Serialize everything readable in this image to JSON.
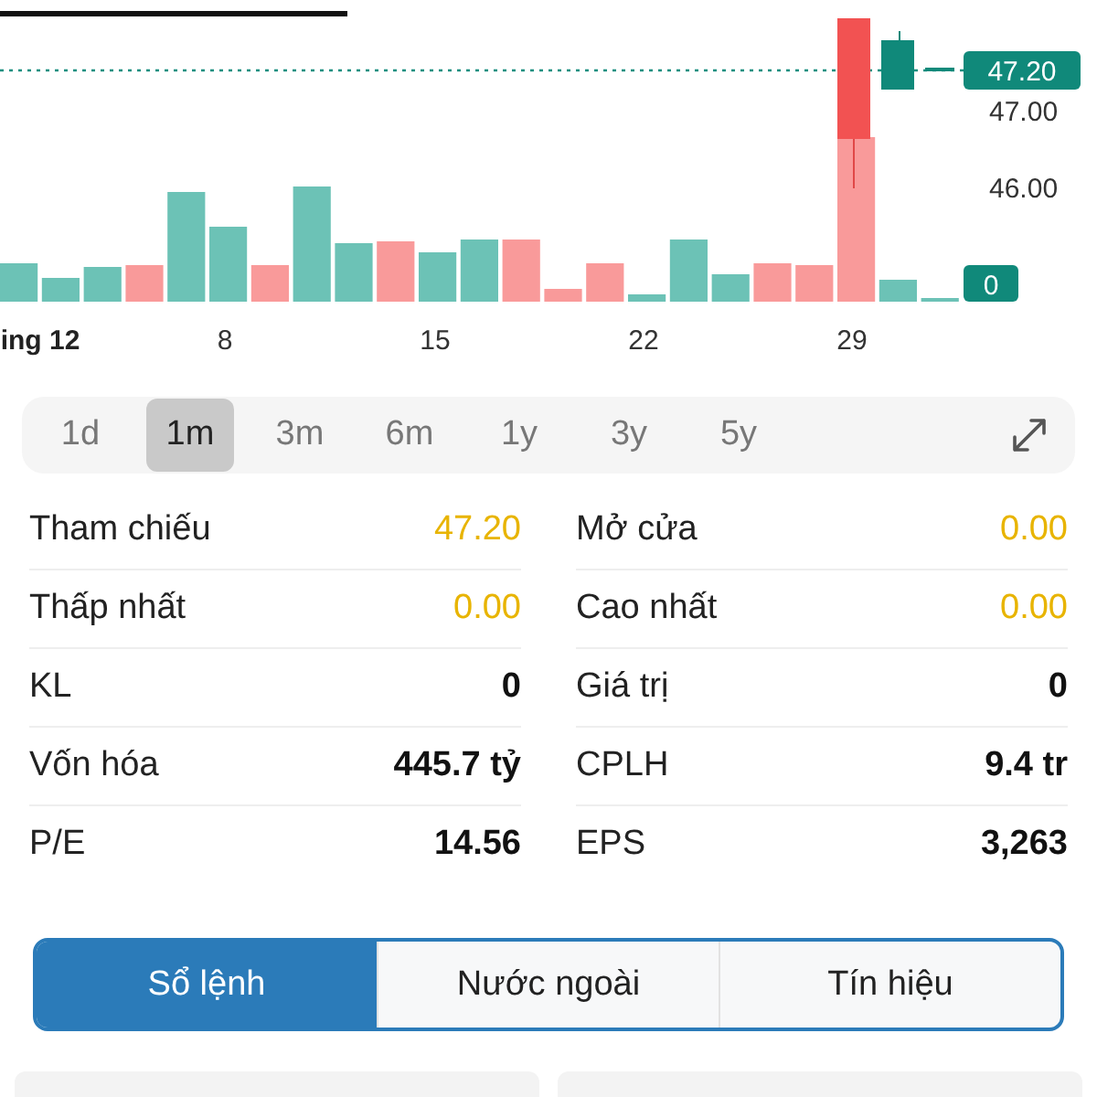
{
  "chart": {
    "price_badge": "47.20",
    "volume_badge": "0",
    "price_ticks": [
      "47.00",
      "46.00"
    ],
    "x_labels": [
      "ing 12",
      "8",
      "15",
      "22",
      "29"
    ]
  },
  "ranges": [
    {
      "label": "1d",
      "selected": false
    },
    {
      "label": "1m",
      "selected": true
    },
    {
      "label": "3m",
      "selected": false
    },
    {
      "label": "6m",
      "selected": false
    },
    {
      "label": "1y",
      "selected": false
    },
    {
      "label": "3y",
      "selected": false
    },
    {
      "label": "5y",
      "selected": false
    }
  ],
  "stats_left": [
    {
      "label": "Tham chiếu",
      "value": "47.20",
      "kind": "price"
    },
    {
      "label": "Thấp nhất",
      "value": "0.00",
      "kind": "price"
    },
    {
      "label": "KL",
      "value": "0",
      "kind": "stat"
    },
    {
      "label": "Vốn hóa",
      "value": "445.7 tỷ",
      "kind": "stat"
    },
    {
      "label": "P/E",
      "value": "14.56",
      "kind": "stat"
    }
  ],
  "stats_right": [
    {
      "label": "Mở cửa",
      "value": "0.00",
      "kind": "price"
    },
    {
      "label": "Cao nhất",
      "value": "0.00",
      "kind": "price"
    },
    {
      "label": "Giá trị",
      "value": "0",
      "kind": "stat"
    },
    {
      "label": "CPLH",
      "value": "9.4 tr",
      "kind": "stat"
    },
    {
      "label": "EPS",
      "value": "3,263",
      "kind": "stat"
    }
  ],
  "tabs": [
    {
      "label": "Sổ lệnh",
      "selected": true
    },
    {
      "label": "Nước ngoài",
      "selected": false
    },
    {
      "label": "Tín hiệu",
      "selected": false
    }
  ]
}
